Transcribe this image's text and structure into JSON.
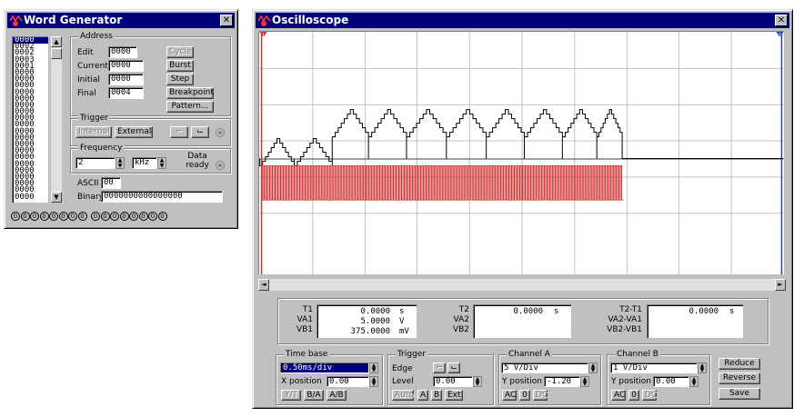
{
  "word_generator": {
    "title": "Word Generator",
    "close_glyph": "✕",
    "words": [
      "0000",
      "0002",
      "0002",
      "0003",
      "0001",
      "0000",
      "0000",
      "0000",
      "0000",
      "0000",
      "0000",
      "0000",
      "0000",
      "0000",
      "0000",
      "0000",
      "0000",
      "0000",
      "0000",
      "0000",
      "0000",
      "0000",
      "0000",
      "0000",
      "0000"
    ],
    "address": {
      "title": "Address",
      "edit_label": "Edit",
      "edit_value": "0000",
      "current_label": "Current",
      "current_value": "0000",
      "initial_label": "Initial",
      "initial_value": "0000",
      "final_label": "Final",
      "final_value": "0004"
    },
    "buttons": {
      "cycle": "Cycle",
      "burst": "Burst",
      "step": "Step",
      "breakpoint": "Breakpoint",
      "pattern": "Pattern..."
    },
    "trigger": {
      "title": "Trigger",
      "internal": "Internal",
      "external": "External",
      "rising_glyph": "⌐",
      "falling_glyph": "⌙"
    },
    "frequency": {
      "title": "Frequency",
      "value": "2",
      "unit": "kHz"
    },
    "data_ready": "Data ready",
    "ascii_label": "ASCII",
    "ascii_value": "00",
    "binary_label": "Binary",
    "binary_value": "0000000000000000",
    "bit_outputs": [
      "0",
      "0",
      "0",
      "0",
      "0",
      "0",
      "0",
      "0",
      "0",
      "0",
      "0",
      "0",
      "0",
      "0",
      "0",
      "0"
    ]
  },
  "oscilloscope": {
    "title": "Oscilloscope",
    "close_glyph": "✕",
    "cursor1_label": "1",
    "cursor2_label": "2",
    "colors": {
      "grid_bg": "#ffffff",
      "grid_line": "#c0c0c0",
      "channel_a": "#000000",
      "channel_b": "#d03030",
      "cursor1": "#d03030",
      "cursor2": "#2040c0"
    },
    "scroll_left": "◄",
    "scroll_right": "►",
    "readout": {
      "t1_label": "T1",
      "t1_value": "0.0000",
      "t1_unit": "s",
      "va1_label": "VA1",
      "va1_value": "5.0000",
      "va1_unit": "V",
      "vb1_label": "VB1",
      "vb1_value": "375.0000",
      "vb1_unit": "mV",
      "t2_label": "T2",
      "t2_value": "0.0000",
      "t2_unit": "s",
      "va2_label": "VA2",
      "vb2_label": "VB2",
      "t2t1_label": "T2-T1",
      "t2t1_value": "0.0000",
      "t2t1_unit": "s",
      "va2va1_label": "VA2-VA1",
      "vb2vb1_label": "VB2-VB1"
    },
    "timebase": {
      "title": "Time base",
      "value": "0.50ms/div",
      "xpos_label": "X position",
      "xpos_value": "0.00",
      "yt": "Y/T",
      "ba": "B/A",
      "ab": "A/B"
    },
    "trigger": {
      "title": "Trigger",
      "edge_label": "Edge",
      "level_label": "Level",
      "level_value": "0.00",
      "auto": "Auto",
      "a": "A",
      "b": "B",
      "ext": "Ext"
    },
    "channel_a": {
      "title": "Channel A",
      "value": "5 V/Div",
      "ypos_label": "Y position",
      "ypos_value": "-1.20",
      "ac": "AC",
      "zero": "0",
      "dc": "DC"
    },
    "channel_b": {
      "title": "Channel B",
      "value": "1 V/Div",
      "ypos_label": "Y position",
      "ypos_value": "0.00",
      "ac": "AC",
      "zero": "0",
      "dc": "DC"
    },
    "reduce": "Reduce",
    "reverse": "Reverse",
    "save": "Save"
  }
}
